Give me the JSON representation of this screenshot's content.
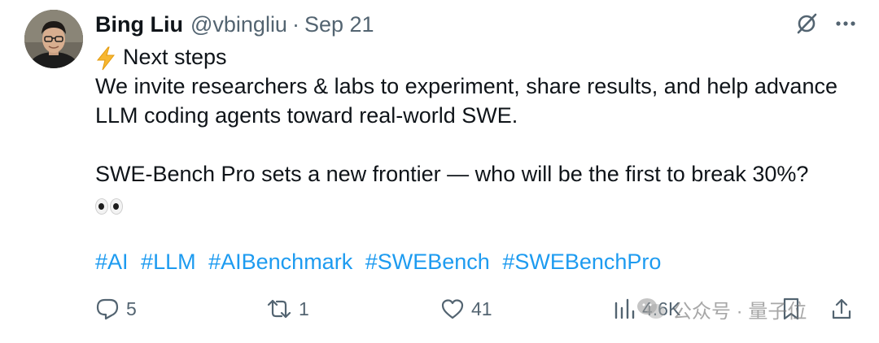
{
  "author": {
    "name": "Bing Liu",
    "handle": "@vbingliu",
    "separator": "·",
    "date": "Sep 21"
  },
  "tweet": {
    "lines": [
      "Next steps",
      "We invite researchers & labs to experiment, share results, and help advance",
      "LLM coding agents toward real-world SWE.",
      "",
      "SWE-Bench Pro sets a new frontier — who will be the first to break 30%?"
    ],
    "lead_emoji": "lightning-emoji",
    "trailing_emoji": "eyes-emoji",
    "hashtags": [
      "#AI",
      "#LLM",
      "#AIBenchmark",
      "#SWEBench",
      "#SWEBenchPro"
    ]
  },
  "actions": {
    "replies": "5",
    "reposts": "1",
    "likes": "41",
    "views": "4.6K"
  },
  "watermark": {
    "text": "公众号 · 量子位"
  },
  "colors": {
    "text": "#0f1419",
    "muted": "#536471",
    "link": "#1d9bf0"
  }
}
